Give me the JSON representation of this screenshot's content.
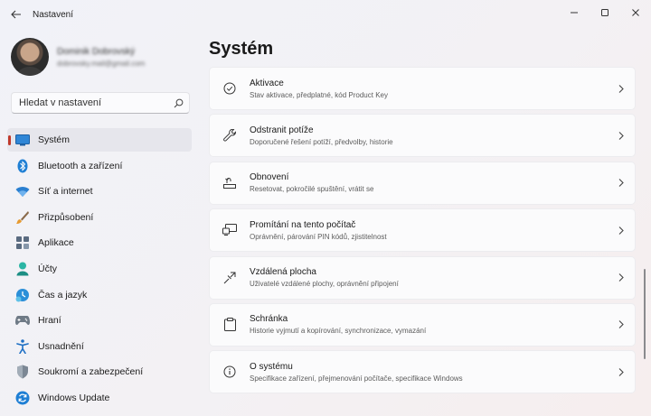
{
  "window": {
    "title": "Nastavení",
    "back_icon": "back-arrow-icon",
    "controls": [
      "minimize-icon",
      "maximize-icon",
      "close-icon"
    ]
  },
  "profile": {
    "name": "Dominik Dobrovský",
    "email": "dobrovsky.mail@gmail.com"
  },
  "search": {
    "placeholder": "Hledat v nastavení",
    "icon": "search-icon"
  },
  "sidebar": {
    "items": [
      {
        "label": "Systém",
        "icon": "system-icon",
        "selected": true
      },
      {
        "label": "Bluetooth a zařízení",
        "icon": "bluetooth-icon"
      },
      {
        "label": "Síť a internet",
        "icon": "wifi-icon"
      },
      {
        "label": "Přizpůsobení",
        "icon": "brush-icon"
      },
      {
        "label": "Aplikace",
        "icon": "apps-icon"
      },
      {
        "label": "Účty",
        "icon": "account-icon"
      },
      {
        "label": "Čas a jazyk",
        "icon": "time-language-icon"
      },
      {
        "label": "Hraní",
        "icon": "gamepad-icon"
      },
      {
        "label": "Usnadnění",
        "icon": "accessibility-icon"
      },
      {
        "label": "Soukromí a zabezpečení",
        "icon": "shield-icon"
      },
      {
        "label": "Windows Update",
        "icon": "update-icon"
      }
    ]
  },
  "main": {
    "title": "Systém",
    "cards": [
      {
        "title": "Aktivace",
        "subtitle": "Stav aktivace, předplatné, kód Product Key",
        "icon": "activation-check-icon"
      },
      {
        "title": "Odstranit potíže",
        "subtitle": "Doporučené řešení potíží, předvolby, historie",
        "icon": "wrench-icon"
      },
      {
        "title": "Obnovení",
        "subtitle": "Resetovat, pokročilé spuštění, vrátit se",
        "icon": "recovery-icon"
      },
      {
        "title": "Promítání na tento počítač",
        "subtitle": "Oprávnění, párování PIN kódů, zjistitelnost",
        "icon": "projection-icon"
      },
      {
        "title": "Vzdálená plocha",
        "subtitle": "Uživatelé vzdálené plochy, oprávnění připojení",
        "icon": "remote-desktop-icon"
      },
      {
        "title": "Schránka",
        "subtitle": "Historie vyjmutí a kopírování, synchronizace, vymazání",
        "icon": "clipboard-icon"
      },
      {
        "title": "O systému",
        "subtitle": "Specifikace zařízení, přejmenování počítače, specifikace Windows",
        "icon": "info-icon"
      }
    ]
  }
}
